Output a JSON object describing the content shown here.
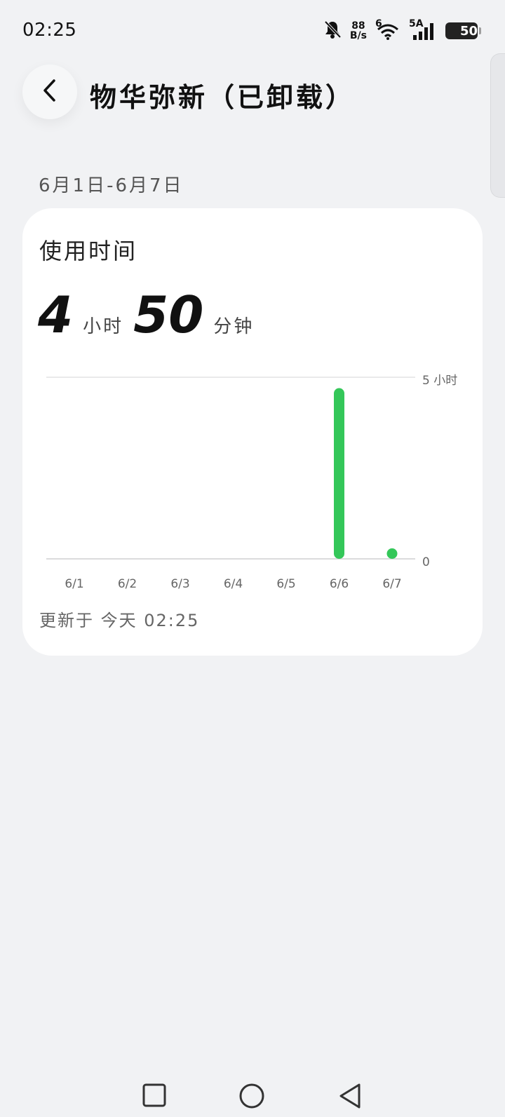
{
  "status_bar": {
    "time": "02:25",
    "net_speed_value": "88",
    "net_speed_unit": "B/s",
    "wifi_label": "6",
    "cell_label": "5A",
    "battery": "50",
    "icons": [
      "mute-bell-icon",
      "wifi-icon",
      "signal-icon",
      "battery-icon"
    ]
  },
  "header": {
    "title": "物华弥新（已卸载）"
  },
  "date_range": "6月1日-6月7日",
  "card": {
    "heading": "使用时间",
    "hours_value": "4",
    "hours_unit": "小时",
    "minutes_value": "50",
    "minutes_unit": "分钟",
    "updated": "更新于 今天 02:25"
  },
  "colors": {
    "accent": "#34c759",
    "background": "#f1f2f4",
    "card": "#ffffff"
  },
  "chart_data": {
    "type": "bar",
    "categories": [
      "6/1",
      "6/2",
      "6/3",
      "6/4",
      "6/5",
      "6/6",
      "6/7"
    ],
    "values": [
      0,
      0,
      0,
      0,
      0,
      4.7,
      0.15
    ],
    "y_unit": "小时",
    "y_tick_labels": [
      "5 小时",
      "0"
    ],
    "ylim": [
      0,
      5
    ],
    "bar_color": "#34c759"
  },
  "nav": {
    "icons": [
      "recents-square-icon",
      "home-circle-icon",
      "back-triangle-icon"
    ]
  }
}
